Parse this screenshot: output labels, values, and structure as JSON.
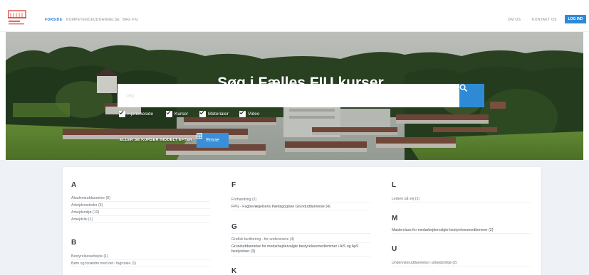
{
  "colors": {
    "accent": "#2f8ad6",
    "page_background": "#eef1f5",
    "card": "#ffffff"
  },
  "nav": {
    "links": [
      {
        "label": "FORSIDE",
        "active": true
      },
      {
        "label": "KOMPETENCEUDDANNELSE",
        "active": false
      },
      {
        "label": "BAG FIU",
        "active": false
      }
    ],
    "right_links": [
      "OM OS",
      "KONTAKT OS"
    ],
    "button_label": "LOG IND"
  },
  "hero": {
    "title": "Søg i Fælles FIU kurser",
    "search_placeholder": "Søg",
    "search_icon": "search-icon",
    "filters": [
      {
        "label": "Hjemmeside",
        "checked": true
      },
      {
        "label": "Kurser",
        "checked": true
      },
      {
        "label": "Materialer",
        "checked": true
      },
      {
        "label": "Video",
        "checked": true
      }
    ],
    "browse_label": "ELLER SE KURSER INDDELT EFTER",
    "browse_button": "Emne",
    "browse_icon": "grid-icon"
  },
  "index": {
    "columns": [
      {
        "sections": [
          {
            "letter": "A",
            "items": [
              "Akademiuddannelse (8)",
              "Arbejdsmetoder (5)",
              "Arbejdsmiljø (13)",
              "Arbejdsliv (1)"
            ]
          },
          {
            "letter": "B",
            "items": [
              "Bestyrelsesarbejde (1)",
              "Børn og forældre med del i fagrotale (1)"
            ]
          }
        ]
      },
      {
        "sections": [
          {
            "letter": "F",
            "items": [
              "Forhandling (2)",
              "FPG - Fagbevægelsens Pædagogiske Grunduddannelse (4)"
            ]
          },
          {
            "letter": "G",
            "items": [
              "Grafisk facilitering - for undervisere (4)",
              "Grunduddannelse for medarbejdervalgte bestyrelsesmedlemmer i A/S og ApS bestyrelser (3)"
            ]
          },
          {
            "letter": "K",
            "items": []
          }
        ]
      },
      {
        "sections": [
          {
            "letter": "L",
            "items": [
              "Ledere på vej (1)"
            ]
          },
          {
            "letter": "M",
            "items": [
              "Masterclass for medarbejdervalgte bestyrelsesmedlemmer (2)"
            ]
          },
          {
            "letter": "U",
            "items": [
              "Underviseruddannelse i arbejdsmiljø (2)"
            ]
          }
        ]
      }
    ]
  }
}
